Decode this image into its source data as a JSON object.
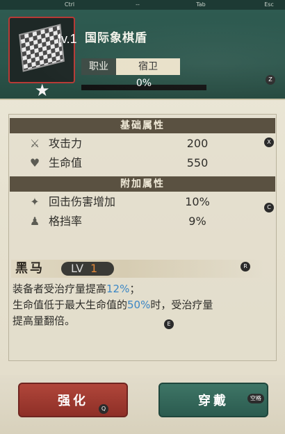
{
  "hints": {
    "ctrl": "Ctrl",
    "dash": "--",
    "tab": "Tab",
    "esc": "Esc"
  },
  "item": {
    "level": "lv.1",
    "name": "国际象棋盾",
    "job_label": "职业",
    "job_value": "宿卫",
    "progress_text": "0%",
    "progress_value": 0
  },
  "badges": {
    "z": "Z",
    "x": "X",
    "c": "C",
    "r": "R",
    "e": "E",
    "q": "Q",
    "space": "空格"
  },
  "base_attributes": {
    "title": "基础属性",
    "rows": [
      {
        "label": "攻击力",
        "value": "200",
        "icon": "crossed-swords-icon"
      },
      {
        "label": "生命值",
        "value": "550",
        "icon": "heart-icon"
      }
    ]
  },
  "extra_attributes": {
    "title": "附加属性",
    "rows": [
      {
        "label": "回击伤害增加",
        "value": "10%",
        "icon": "counter-damage-icon"
      },
      {
        "label": "格挡率",
        "value": "9%",
        "icon": "block-icon"
      }
    ]
  },
  "skill": {
    "name": "黑马",
    "lv_label": "LV",
    "lv_value": "1",
    "desc_line1_a": "装备者受治疗量提高",
    "desc_line1_b": "12%",
    "desc_line1_c": "；",
    "desc_line2_a": "生命值低于最大生命值的",
    "desc_line2_b": "50%",
    "desc_line2_c": "时，受治疗量",
    "desc_line3": "提高量翻倍。"
  },
  "buttons": {
    "upgrade": "强化",
    "equip": "穿戴"
  },
  "colors": {
    "header_bg": "#2e5b51",
    "accent_blue": "#3b86c4",
    "skill_level_orange": "#e0883a",
    "upgrade_red": "#9a382f",
    "equip_green": "#346a5c"
  }
}
